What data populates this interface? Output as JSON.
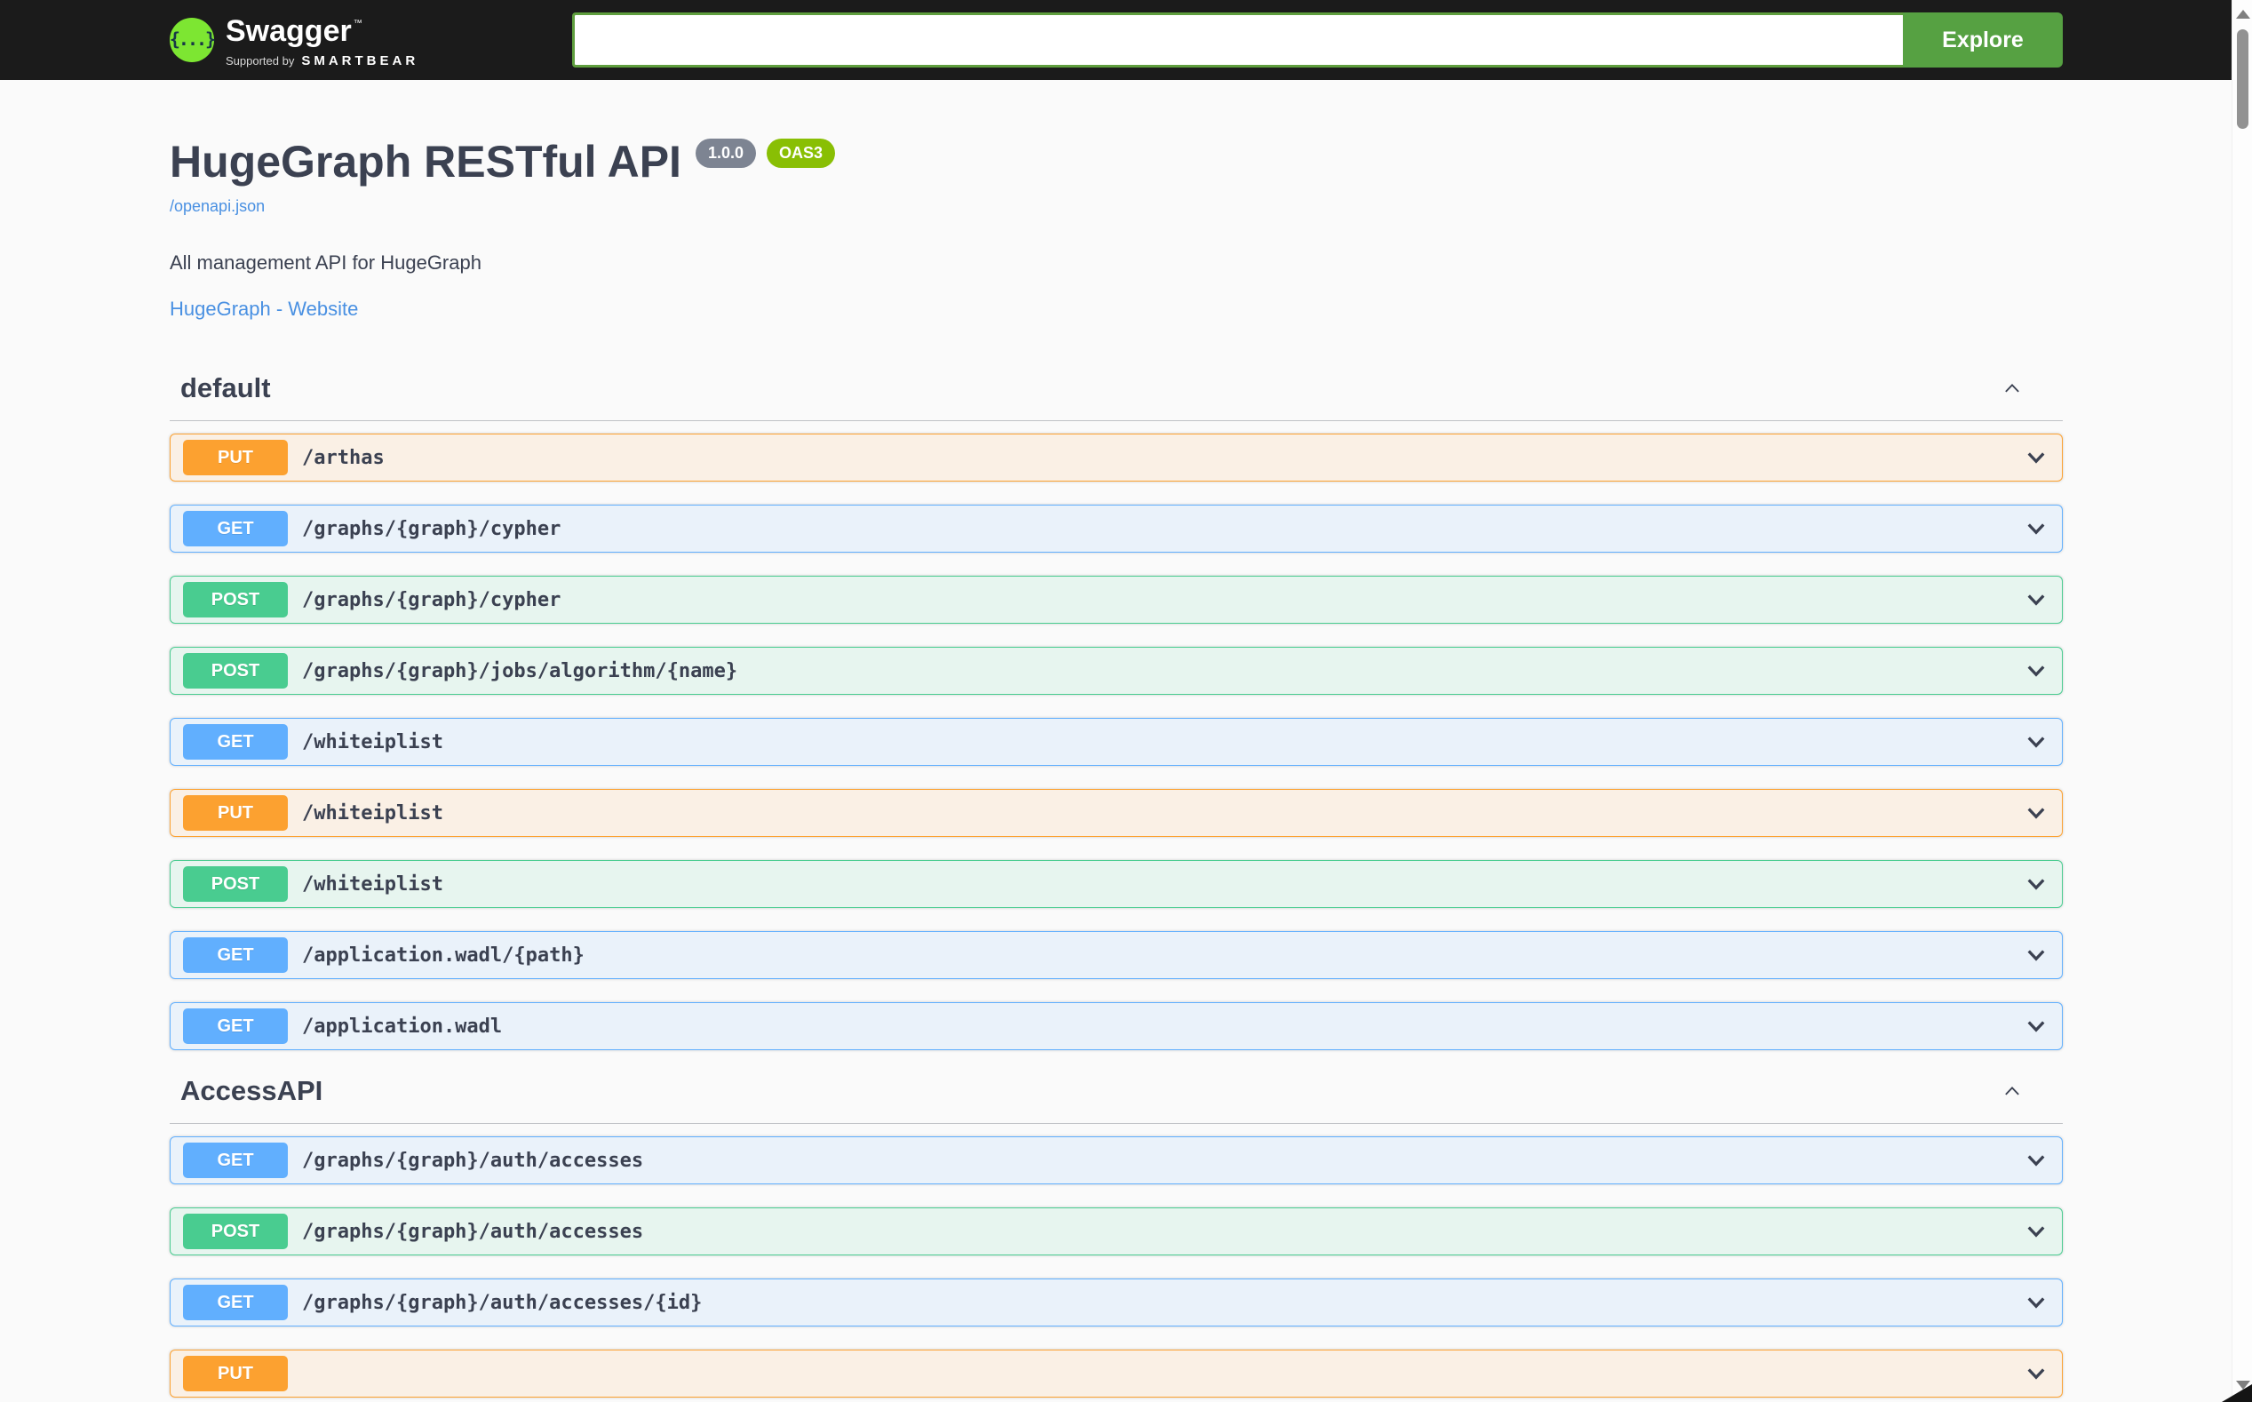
{
  "topbar": {
    "logo": {
      "brand": "Swagger",
      "trademark": "™",
      "braces_glyph": "{...}",
      "supported_by": "Supported by",
      "supporter": "SMARTBEAR"
    },
    "search": {
      "value": "",
      "placeholder": ""
    },
    "explore_label": "Explore"
  },
  "info": {
    "title": "HugeGraph RESTful API",
    "version_badge": "1.0.0",
    "spec_badge": "OAS3",
    "spec_link": "/openapi.json",
    "description": "All management API for HugeGraph",
    "external_link": "HugeGraph - Website"
  },
  "colors": {
    "topbar_bg": "#1b1b1b",
    "page_bg": "#fafafa",
    "text": "#3b4151",
    "link_blue": "#4990e2",
    "explore_green": "#56a142",
    "logo_green": "#7de632",
    "version_badge_gray": "#7d8492",
    "oas3_green": "#89bf04",
    "get_blue": "#61affe",
    "post_green": "#49cc90",
    "put_orange": "#fca130"
  },
  "sections": [
    {
      "name": "default",
      "expanded": true,
      "endpoints": [
        {
          "method": "PUT",
          "path": "/arthas"
        },
        {
          "method": "GET",
          "path": "/graphs/{graph}/cypher"
        },
        {
          "method": "POST",
          "path": "/graphs/{graph}/cypher"
        },
        {
          "method": "POST",
          "path": "/graphs/{graph}/jobs/algorithm/{name}"
        },
        {
          "method": "GET",
          "path": "/whiteiplist"
        },
        {
          "method": "PUT",
          "path": "/whiteiplist"
        },
        {
          "method": "POST",
          "path": "/whiteiplist"
        },
        {
          "method": "GET",
          "path": "/application.wadl/{path}"
        },
        {
          "method": "GET",
          "path": "/application.wadl"
        }
      ]
    },
    {
      "name": "AccessAPI",
      "expanded": true,
      "endpoints": [
        {
          "method": "GET",
          "path": "/graphs/{graph}/auth/accesses"
        },
        {
          "method": "POST",
          "path": "/graphs/{graph}/auth/accesses"
        },
        {
          "method": "GET",
          "path": "/graphs/{graph}/auth/accesses/{id}"
        },
        {
          "method": "PUT",
          "path": ""
        }
      ]
    }
  ]
}
